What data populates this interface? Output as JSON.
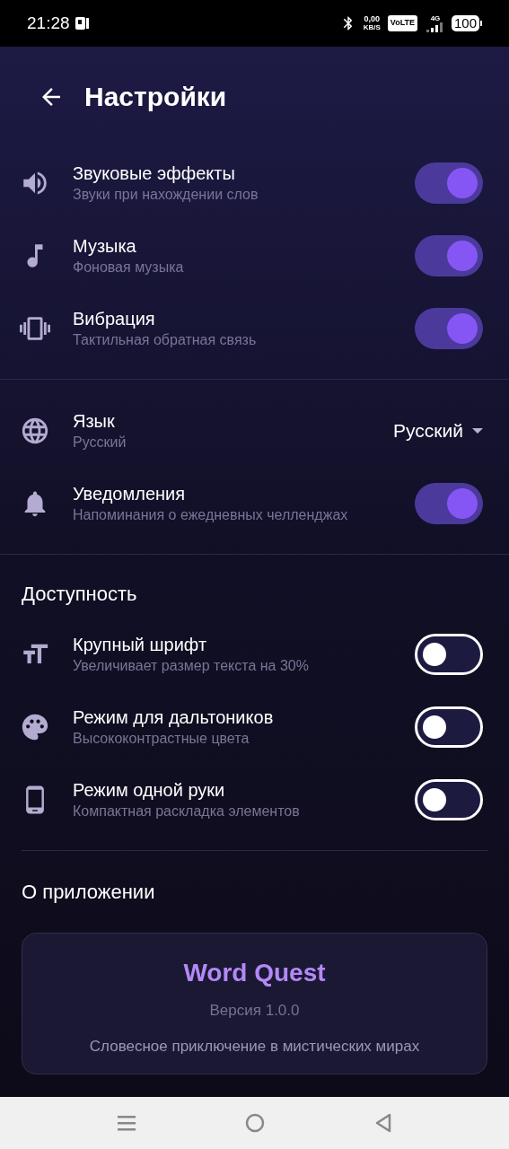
{
  "status_bar": {
    "time": "21:28",
    "net_speed": "0,00",
    "net_unit": "KB/S",
    "volte": "VoLTE",
    "network": "4G",
    "battery": "100"
  },
  "header": {
    "title": "Настройки"
  },
  "groups": [
    {
      "items": [
        {
          "kind": "toggle",
          "title": "Звуковые эффекты",
          "subtitle": "Звуки при нахождении слов",
          "on": true
        },
        {
          "kind": "toggle",
          "title": "Музыка",
          "subtitle": "Фоновая музыка",
          "on": true
        },
        {
          "kind": "toggle",
          "title": "Вибрация",
          "subtitle": "Тактильная обратная связь",
          "on": true
        }
      ]
    },
    {
      "items": [
        {
          "kind": "dropdown",
          "title": "Язык",
          "subtitle": "Русский",
          "value": "Русский"
        },
        {
          "kind": "toggle",
          "title": "Уведомления",
          "subtitle": "Напоминания о ежедневных челленджах",
          "on": true
        }
      ]
    },
    {
      "heading": "Доступность",
      "items": [
        {
          "kind": "toggle",
          "title": "Крупный шрифт",
          "subtitle": "Увеличивает размер текста на 30%",
          "on": false
        },
        {
          "kind": "toggle",
          "title": "Режим для дальтоников",
          "subtitle": "Высококонтрастные цвета",
          "on": false
        },
        {
          "kind": "toggle",
          "title": "Режим одной руки",
          "subtitle": "Компактная раскладка элементов",
          "on": false
        }
      ]
    }
  ],
  "about": {
    "heading": "О приложении",
    "app_name": "Word Quest",
    "version": "Версия 1.0.0",
    "tagline": "Словесное приключение в мистических мирах"
  }
}
